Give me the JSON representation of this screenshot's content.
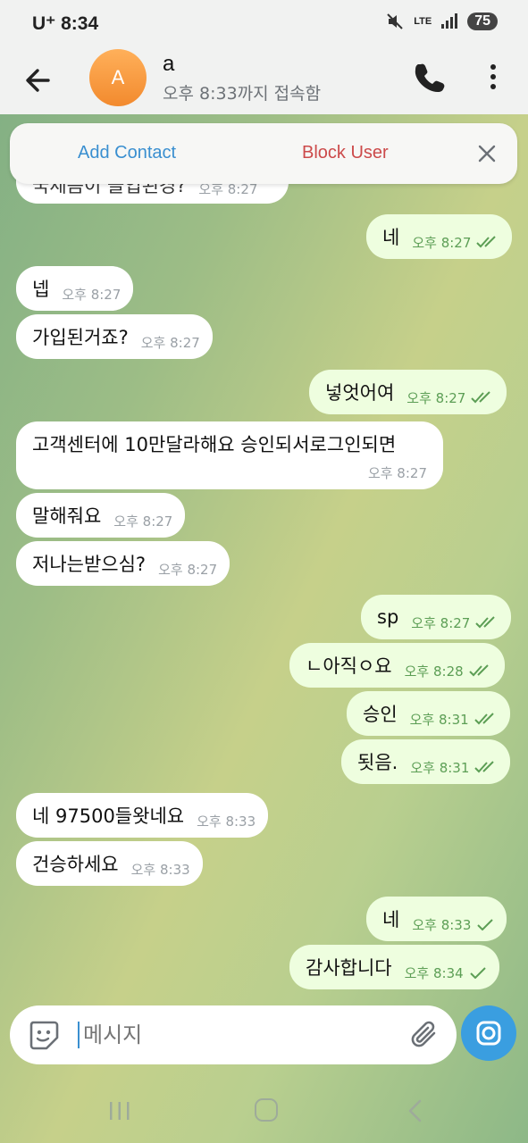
{
  "status_bar": {
    "carrier": "U⁺",
    "time": "8:34",
    "network": "LTE",
    "battery": "75"
  },
  "header": {
    "avatar_letter": "A",
    "title": "a",
    "subtitle": "오후 8:33까지 접속함"
  },
  "action_bar": {
    "add_contact": "Add Contact",
    "block_user": "Block User"
  },
  "partial_message": {
    "text": "국세음이 들입된경?",
    "time": "오후 8:27"
  },
  "messages": [
    {
      "dir": "out",
      "text": "네",
      "time": "오후 8:27",
      "status": "read"
    },
    {
      "dir": "in",
      "text": "넵",
      "time": "오후 8:27"
    },
    {
      "dir": "in",
      "text": "가입된거죠?",
      "time": "오후 8:27"
    },
    {
      "dir": "out",
      "text": "넣엇어여",
      "time": "오후 8:27",
      "status": "read"
    },
    {
      "dir": "in",
      "text": "고객센터에 10만달라해요 승인되서로그인되면",
      "time": "오후 8:27"
    },
    {
      "dir": "in",
      "text": "말해줘요",
      "time": "오후 8:27"
    },
    {
      "dir": "in",
      "text": "저나는받으심?",
      "time": "오후 8:27"
    },
    {
      "dir": "out",
      "text": "sp",
      "time": "오후 8:27",
      "status": "read"
    },
    {
      "dir": "out",
      "text": "ㄴ아직ㅇ요",
      "time": "오후 8:28",
      "status": "read"
    },
    {
      "dir": "out",
      "text": "승인",
      "time": "오후 8:31",
      "status": "read"
    },
    {
      "dir": "out",
      "text": "됫음.",
      "time": "오후 8:31",
      "status": "read"
    },
    {
      "dir": "in",
      "text": "네 97500들왓네요",
      "time": "오후 8:33"
    },
    {
      "dir": "in",
      "text": "건승하세요",
      "time": "오후 8:33"
    },
    {
      "dir": "out",
      "text": "네",
      "time": "오후 8:33",
      "status": "sent"
    },
    {
      "dir": "out",
      "text": "감사합니다",
      "time": "오후 8:34",
      "status": "sent"
    }
  ],
  "input": {
    "placeholder": "메시지"
  },
  "colors": {
    "accent": "#3a9ee0",
    "outgoing_bubble": "#eefedf",
    "incoming_bubble": "#ffffff",
    "block_red": "#cc4a4a"
  }
}
